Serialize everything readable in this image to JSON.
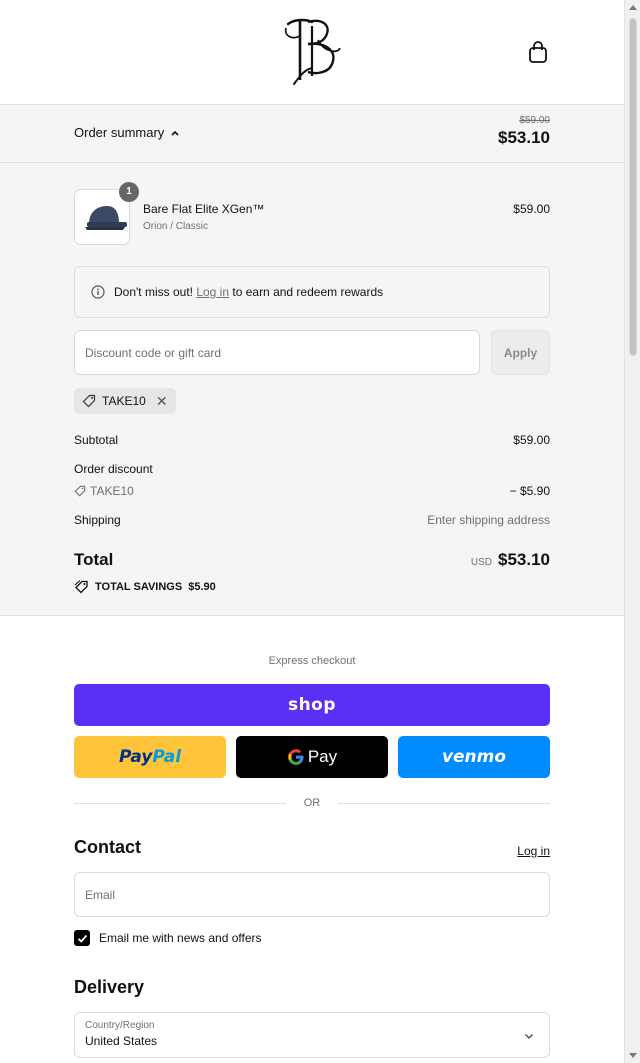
{
  "brand": {
    "logo_icon": "monogram-bb-logo",
    "cart_icon": "shopping-bag-icon"
  },
  "summary_bar": {
    "label": "Order summary",
    "original_price": "$59.00",
    "current_price": "$53.10"
  },
  "product": {
    "quantity": "1",
    "name": "Bare Flat Elite XGen™",
    "variant": "Orion / Classic",
    "price": "$59.00",
    "image_icon": "cap-icon"
  },
  "rewards": {
    "prefix": "Don't miss out!",
    "link": "Log in",
    "suffix": "to earn and redeem rewards"
  },
  "discount": {
    "placeholder": "Discount code or gift card",
    "apply_label": "Apply",
    "applied_code": "TAKE10"
  },
  "totals": {
    "subtotal_label": "Subtotal",
    "subtotal_value": "$59.00",
    "discount_label": "Order discount",
    "discount_code": "TAKE10",
    "discount_value": "− $5.90",
    "shipping_label": "Shipping",
    "shipping_value": "Enter shipping address",
    "total_label": "Total",
    "currency": "USD",
    "total_value": "$53.10",
    "savings_label": "TOTAL SAVINGS",
    "savings_value": "$5.90"
  },
  "express": {
    "label": "Express checkout",
    "shop_label": "shop",
    "paypal_part1": "Pay",
    "paypal_part2": "Pal",
    "gpay_label": "Pay",
    "venmo_label": "venmo",
    "or_label": "OR"
  },
  "contact": {
    "title": "Contact",
    "login_label": "Log in",
    "email_placeholder": "Email",
    "newsletter_label": "Email me with news and offers",
    "newsletter_checked": true
  },
  "delivery": {
    "title": "Delivery",
    "country_label": "Country/Region",
    "country_value": "United States"
  },
  "colors": {
    "shop": "#5a31f4",
    "paypal": "#ffc439",
    "gpay": "#000000",
    "venmo": "#008cff"
  }
}
